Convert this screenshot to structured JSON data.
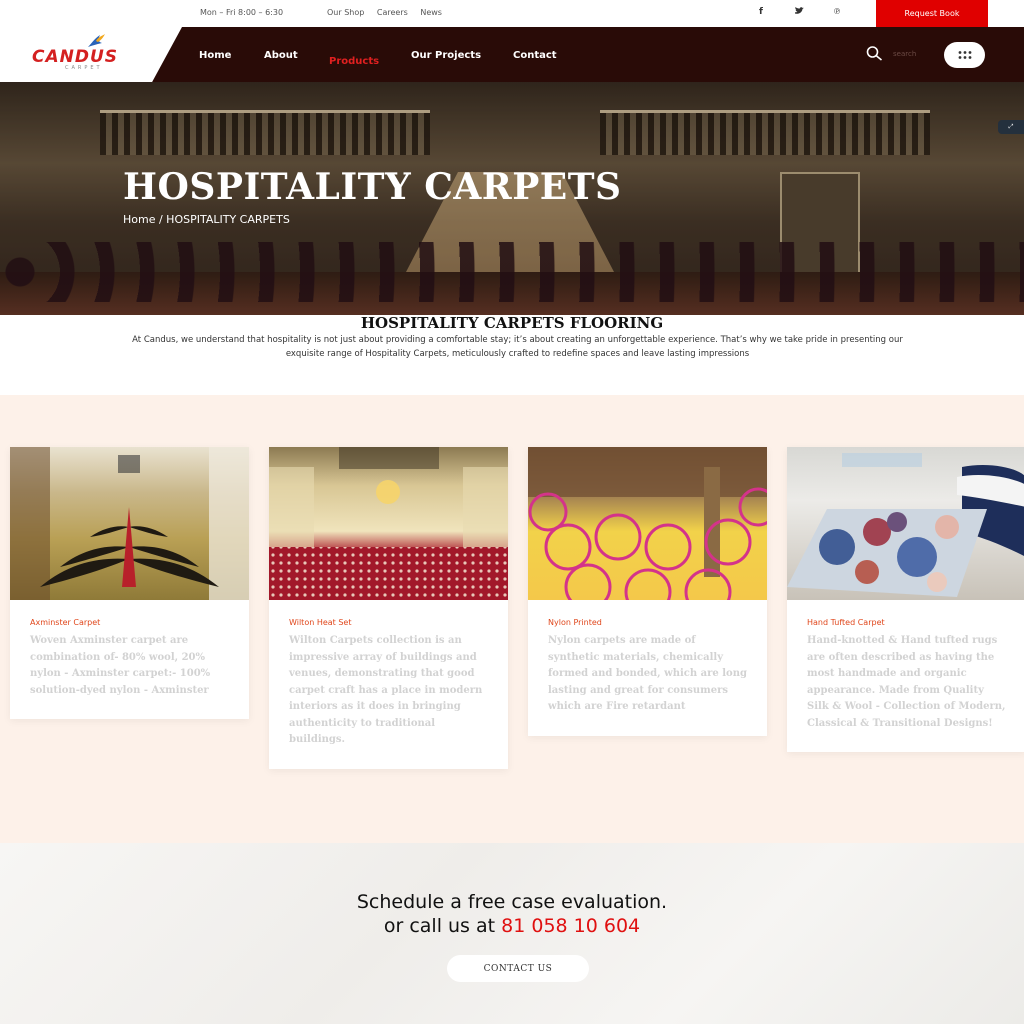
{
  "topbar": {
    "hours": "Mon – Fri 8:00 – 6:30",
    "links": [
      "Our Shop",
      "Careers",
      "News"
    ],
    "social": [
      "facebook-icon",
      "twitter-icon",
      "pinterest-icon"
    ],
    "request_button": "Request Book"
  },
  "brand": {
    "name": "CANDUS",
    "sub": "CARPET"
  },
  "nav": {
    "items": [
      {
        "label": "Home",
        "active": false
      },
      {
        "label": "About",
        "active": false
      },
      {
        "label": "Products",
        "active": true
      },
      {
        "label": "Our Projects",
        "active": false
      },
      {
        "label": "Contact",
        "active": false
      }
    ],
    "search_placeholder": "search"
  },
  "hero": {
    "title": "HOSPITALITY CARPETS",
    "breadcrumb": "Home / HOSPITALITY CARPETS"
  },
  "intro": {
    "title": "HOSPITALITY CARPETS FLOORING",
    "text": "At Candus, we understand that hospitality is not just about providing a comfortable stay; it’s about creating an unforgettable experience. That’s why we take pride in presenting our exquisite range of Hospitality Carpets, meticulously crafted to redefine spaces and leave lasting impressions"
  },
  "products": [
    {
      "category": "Axminster Carpet",
      "description": "Woven Axminster carpet are combination of- 80% wool, 20% nylon - Axminster carpet:- 100% solution-dyed nylon - Axminster"
    },
    {
      "category": "Wilton Heat Set",
      "description": "Wilton Carpets collection is an impressive array of buildings and venues, demonstrating that good carpet craft has a place in modern interiors as it does in bringing authenticity to traditional buildings."
    },
    {
      "category": "Nylon Printed",
      "description": "Nylon carpets are made of synthetic materials, chemically formed and bonded, which are long lasting and great for consumers which are Fire retardant"
    },
    {
      "category": "Hand Tufted Carpet",
      "description": "Hand-knotted & Hand tufted rugs are often described as having the most handmade and organic appearance. Made from Quality Silk & Wool - Collection of Modern, Classical & Transitional Designs!"
    }
  ],
  "cta": {
    "line1": "Schedule a free case evaluation.",
    "line2_prefix": "or call us at",
    "phone": "81 058 10 604",
    "button": "CONTACT US"
  },
  "colors": {
    "accent": "#e00000",
    "header_bg": "#290b07",
    "products_bg": "#fdf1e9",
    "category_text": "#e0471c"
  }
}
